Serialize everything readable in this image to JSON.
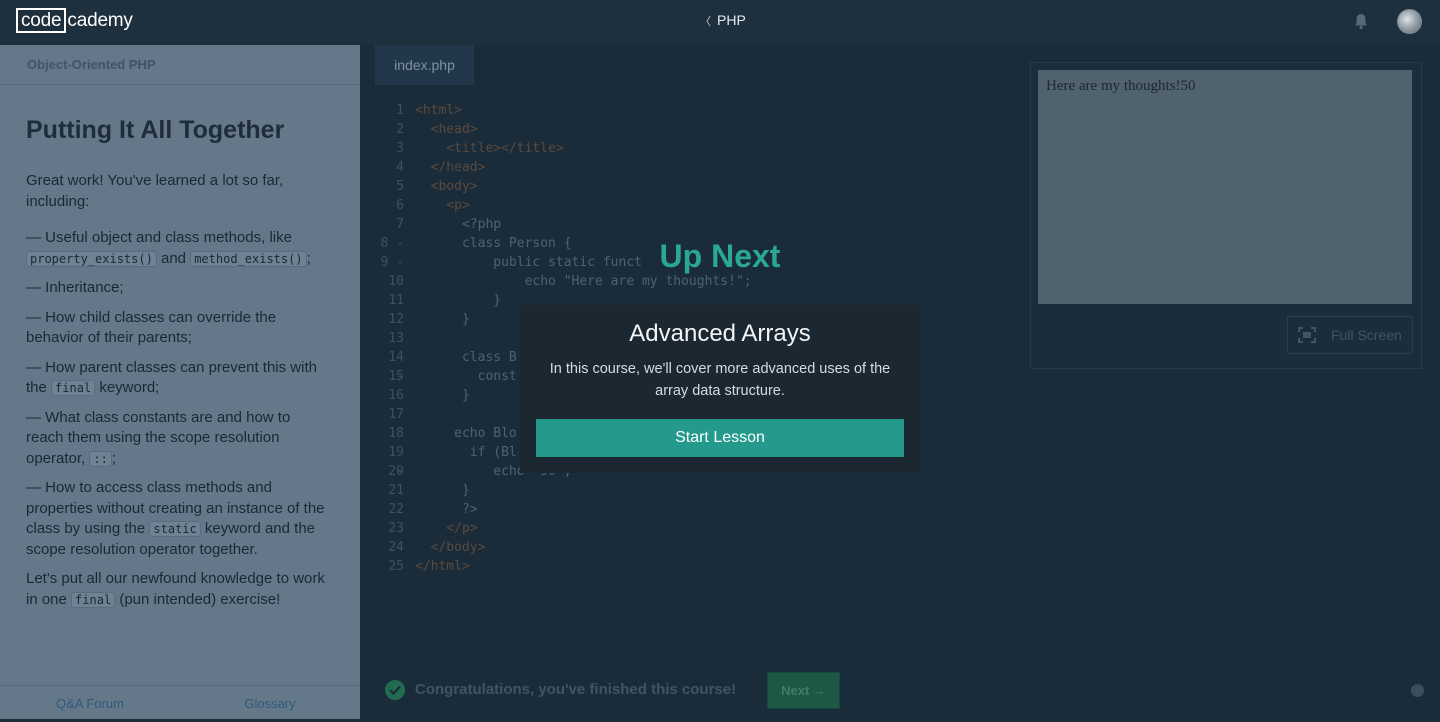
{
  "header": {
    "logo_left": "code",
    "logo_right": "cademy",
    "breadcrumb": "PHP"
  },
  "lesson": {
    "course": "Object-Oriented PHP",
    "title": "Putting It All Together",
    "intro": "Great work! You've learned a lot so far, including:",
    "b1_pre": "— Useful object and class methods, like ",
    "b1_code1": "property_exists()",
    "b1_mid": " and ",
    "b1_code2": "method_exists()",
    "b1_post": ";",
    "b2": "— Inheritance;",
    "b3": "— How child classes can override the behavior of their parents;",
    "b4_pre": "— How parent classes can prevent this with the ",
    "b4_code": "final",
    "b4_post": " keyword;",
    "b5_pre": "— What class constants are and how to reach them using the scope resolution operator, ",
    "b5_code": "::",
    "b5_post": ";",
    "b6_pre": "— How to access class methods and properties without creating an instance of the class by using the ",
    "b6_code": "static",
    "b6_post": " keyword and the scope resolution operator together.",
    "outro_pre": "Let's put all our newfound knowledge to work in one ",
    "outro_code": "final",
    "outro_post": " (pun intended) exercise!",
    "footer": [
      "Q&A Forum",
      "Glossary"
    ]
  },
  "editor": {
    "tab": "index.php",
    "line_numbers": [
      "1",
      "2",
      "3",
      "4",
      "5",
      "6",
      "7",
      "8 -",
      "9 -",
      "10",
      "11",
      "12",
      "13",
      "14 -",
      "15",
      "16",
      "17",
      "18",
      "19 -",
      "20",
      "21",
      "22",
      "23",
      "24",
      "25"
    ],
    "lines": [
      "<html>",
      "  <head>",
      "    <title></title>",
      "  </head>",
      "  <body>",
      "    <p>",
      "      <?php",
      "      class Person {",
      "          public static funct",
      "              echo \"Here are my thoughts!\";",
      "          }",
      "      }",
      "",
      "      class B",
      "        const",
      "      }",
      "",
      "     echo Blo",
      "       if (Bl",
      "          echo \"50\";",
      "      }",
      "      ?>",
      "    </p>",
      "  </body>",
      "</html>"
    ]
  },
  "preview": {
    "output": "Here are my thoughts!50",
    "fullscreen_label": "Full Screen"
  },
  "bottom": {
    "congrats": "Congratulations, you've finished this course!",
    "next_label": "Next →"
  },
  "modal": {
    "up_next": "Up Next",
    "title": "Advanced Arrays",
    "description": "In this course, we'll cover more advanced uses of the array data structure.",
    "start_label": "Start Lesson"
  }
}
